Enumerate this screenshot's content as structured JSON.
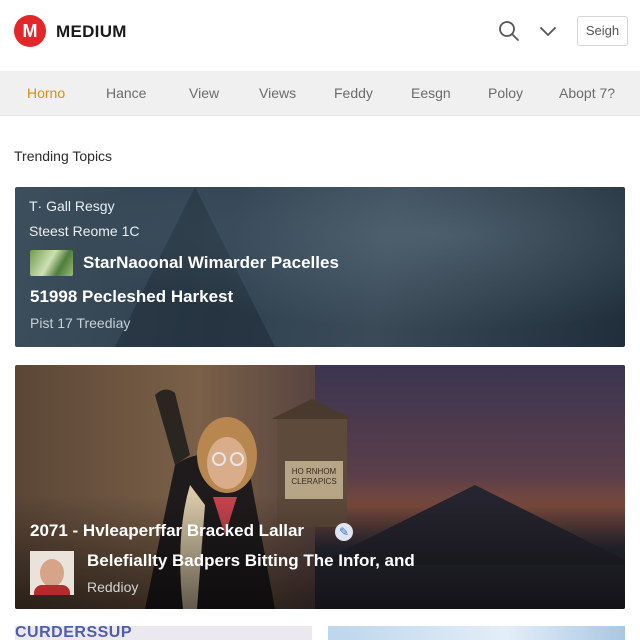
{
  "header": {
    "logo_letter": "M",
    "brand": "MEDIUM",
    "signin_label": "Seigh",
    "accent_color": "#e3262a"
  },
  "nav": {
    "items": [
      "Horno",
      "Hance",
      "View",
      "Views",
      "Feddy",
      "Eesgn",
      "Poloy",
      "Abopt 7?"
    ],
    "active_index": 0,
    "active_color": "#e08a10"
  },
  "section": {
    "title": "Trending Topics"
  },
  "cards": [
    {
      "tag": "T· Gall Resgy",
      "subtitle": "Steest Reome 1C",
      "headline": "StarNaoonal Wimarder Pacelles",
      "headline2": "51998 Pecleshed Harkest",
      "meta": "Pist 17  Treediay"
    },
    {
      "sign_text": "HO RNHOM CLERAPICS",
      "headline": "2071 - Hvleaperffar Bracked Lallar",
      "headline2": "Belefiallty Badpers Bitting The Infor, and",
      "meta": "Reddioy"
    },
    {
      "label": "CURDERSSUP"
    }
  ],
  "icons": [
    "logo-icon",
    "search-icon",
    "chevron-down-icon",
    "emoji-icon",
    "avatar"
  ]
}
